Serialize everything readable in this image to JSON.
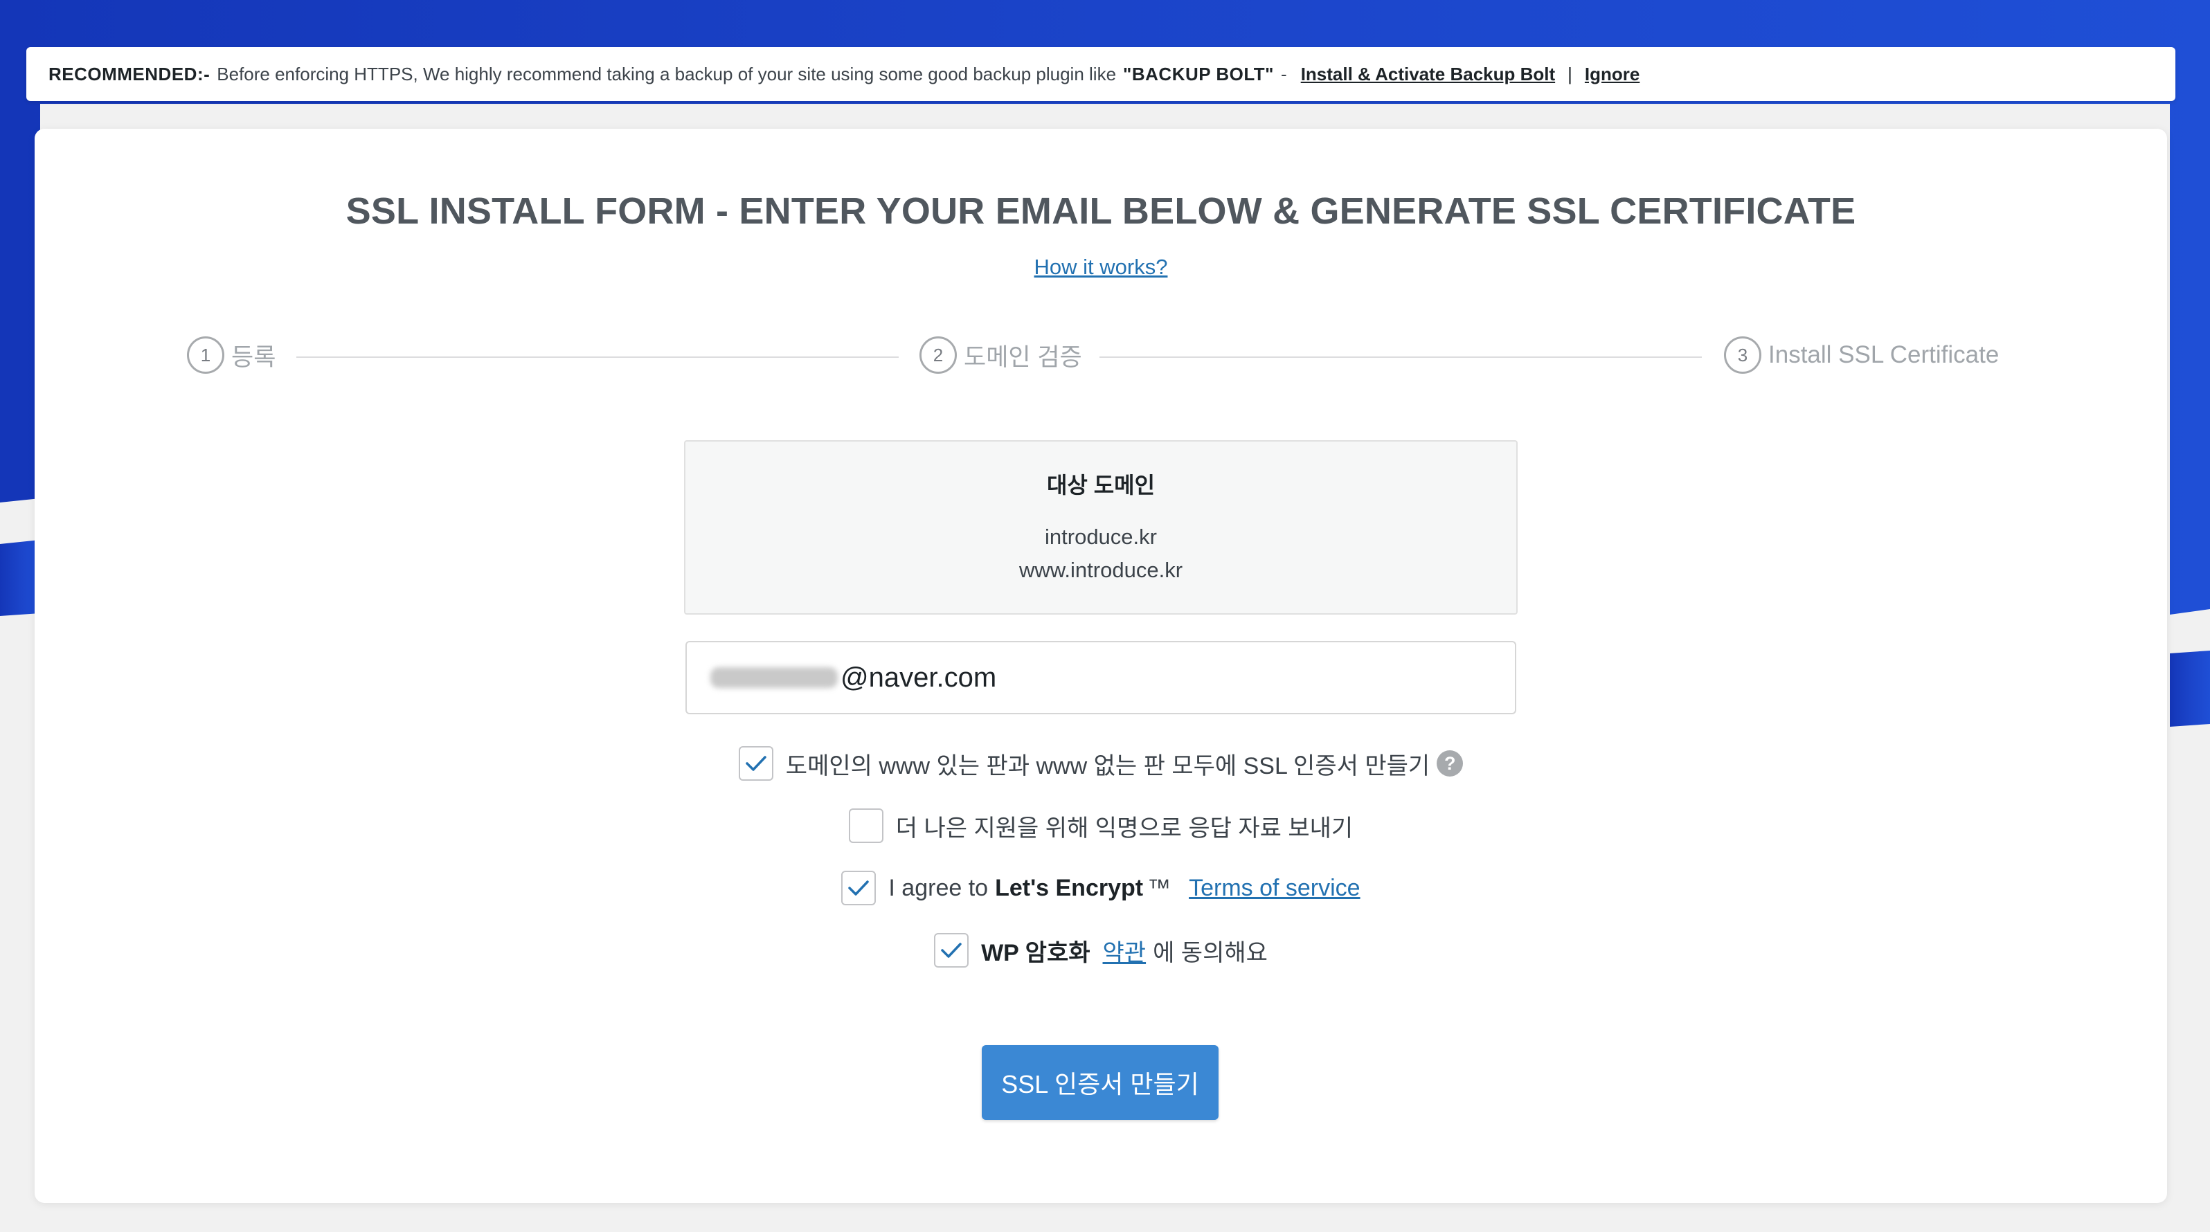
{
  "colors": {
    "backdrop_blue": "#1b44c9",
    "accent": "#3b88d4",
    "link": "#2271b1",
    "checkmark": "#2271b1"
  },
  "notice": {
    "label": "RECOMMENDED:-",
    "text": "Before enforcing HTTPS, We highly recommend taking a backup of your site using some good backup plugin like",
    "plugin": "\"BACKUP BOLT\"",
    "dash": "-",
    "install_link": "Install & Activate Backup Bolt",
    "separator": "|",
    "ignore_link": "Ignore"
  },
  "form": {
    "title": "SSL INSTALL FORM - ENTER YOUR EMAIL BELOW & GENERATE SSL CERTIFICATE",
    "how_link": "How it works?"
  },
  "steps": [
    {
      "num": "1",
      "label": "등록"
    },
    {
      "num": "2",
      "label": "도메인 검증"
    },
    {
      "num": "3",
      "label": "Install SSL Certificate"
    }
  ],
  "domains": {
    "title": "대상 도메인",
    "list": [
      "introduce.kr",
      "www.introduce.kr"
    ]
  },
  "email": {
    "value_suffix": "@naver.com"
  },
  "options": {
    "www_both": {
      "label": "도메인의 www 있는 판과 www 없는 판 모두에 SSL 인증서 만들기",
      "checked": true,
      "help_icon": "?"
    },
    "anonymous": {
      "label": "더 나은 지원을 위해 익명으로 응답 자료 보내기",
      "checked": false
    },
    "letsencrypt": {
      "prefix": "I agree to",
      "brand": "Let's Encrypt",
      "tm": "™",
      "link": "Terms of service",
      "checked": true
    },
    "wp_encryption": {
      "brand": "WP 암호화",
      "link": "약관",
      "suffix": "에 동의해요",
      "checked": true
    }
  },
  "submit_label": "SSL 인증서 만들기"
}
